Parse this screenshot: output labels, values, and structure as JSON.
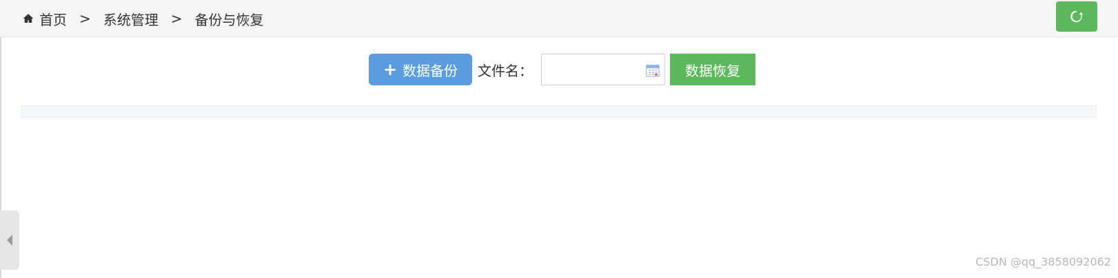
{
  "breadcrumb": {
    "home_icon": "home-icon",
    "items": [
      "首页",
      "系统管理",
      "备份与恢复"
    ],
    "separator": ">"
  },
  "topbar": {
    "refresh_icon": "refresh-icon",
    "refresh_color": "#5cb85c"
  },
  "toolbar": {
    "backup_icon": "plus-icon",
    "backup_label": "数据备份",
    "filename_label": "文件名：",
    "filename_value": "",
    "filename_placeholder": "",
    "calendar_icon": "calendar-icon",
    "restore_label": "数据恢复",
    "backup_color": "#5b9be0",
    "restore_color": "#5cb85c"
  },
  "sidebar_toggle": {
    "icon": "triangle-left-icon"
  },
  "watermark": {
    "text": "CSDN @qq_3858092062"
  }
}
